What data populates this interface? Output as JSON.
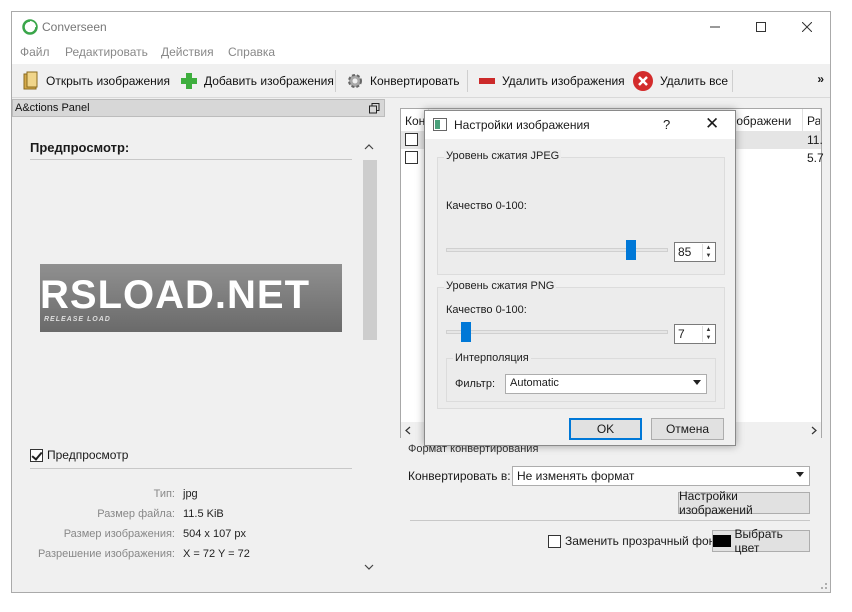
{
  "window": {
    "title": "Converseen"
  },
  "menu": [
    "Файл",
    "Редактировать",
    "Действия",
    "Справка"
  ],
  "toolbar": {
    "open": "Открыть изображения",
    "add": "Добавить изображения",
    "convert": "Конвертировать",
    "remove": "Удалить изображения",
    "remove_all": "Удалить все",
    "more": "»"
  },
  "actions_panel": {
    "title": "A&ctions Panel",
    "preview_title": "Предпросмотр:",
    "preview_checkbox": "Предпросмотр",
    "preview_logo": "RSLOAD.NET",
    "preview_logo_sub": "RELEASE LOAD",
    "info": [
      {
        "label": "Тип:",
        "value": "jpg"
      },
      {
        "label": "Размер файла:",
        "value": "11.5 KiB"
      },
      {
        "label": "Размер изображения:",
        "value": "504 x 107 px"
      },
      {
        "label": "Разрешение изображения:",
        "value": "X = 72 Y = 72"
      }
    ]
  },
  "file_table": {
    "headers": [
      "Кон",
      "зображени",
      "Ра"
    ],
    "rows": [
      {
        "size": "11."
      },
      {
        "size": "5.7"
      }
    ]
  },
  "convert_group": {
    "title": "Формат конвертирования",
    "convert_to_label": "Конвертировать в:",
    "format": "Не изменять формат",
    "settings_button": "Настройки изображений",
    "transparent_label": "Заменить прозрачный фон",
    "color_button": "Выбрать цвет"
  },
  "dialog": {
    "title": "Настройки изображения",
    "help": "?",
    "close": "✕",
    "jpeg": {
      "title": "Уровень сжатия JPEG",
      "quality_label": "Качество 0-100:",
      "value": "85",
      "fraction": 0.85
    },
    "png": {
      "title": "Уровень сжатия PNG",
      "quality_label": "Качество 0-100:",
      "value": "7",
      "fraction": 0.07
    },
    "interp": {
      "title": "Интерполяция",
      "filter_label": "Фильтр:",
      "filter_value": "Automatic"
    },
    "ok": "OK",
    "cancel": "Отмена"
  }
}
